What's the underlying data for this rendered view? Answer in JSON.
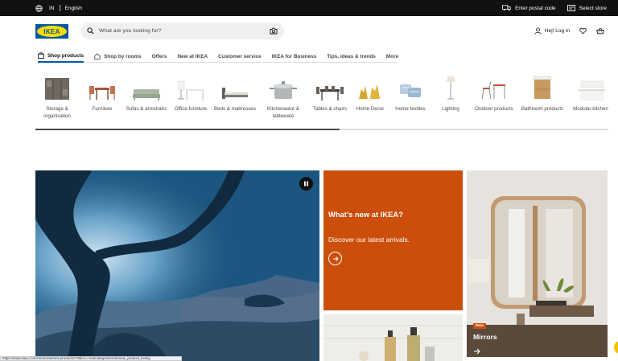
{
  "topbar": {
    "country": "IN",
    "language": "English",
    "postal": "Enter postal code",
    "store": "Select store"
  },
  "header": {
    "logo_text": "IKEA",
    "search_placeholder": "What are you looking for?",
    "login": "Hej! Log in"
  },
  "nav": [
    {
      "label": "Shop products",
      "active": true
    },
    {
      "label": "Shop by rooms"
    },
    {
      "label": "Offers"
    },
    {
      "label": "New at IKEA"
    },
    {
      "label": "Customer service"
    },
    {
      "label": "IKEA for Business"
    },
    {
      "label": "Tips, ideas & trends"
    },
    {
      "label": "More"
    }
  ],
  "categories": [
    {
      "line1": "Storage &",
      "line2": "organisation"
    },
    {
      "line1": "Furniture"
    },
    {
      "line1": "Sofas & armchairs"
    },
    {
      "line1": "Office furniture"
    },
    {
      "line1": "Beds & mattresses"
    },
    {
      "line1": "Kitchenware &",
      "line2": "tableware"
    },
    {
      "line1": "Tables & chairs"
    },
    {
      "line1": "Home Decor"
    },
    {
      "line1": "Home textiles"
    },
    {
      "line1": "Lighting"
    },
    {
      "line1": "Outdoor products"
    },
    {
      "line1": "Bathroom products"
    },
    {
      "line1": "Modular kitchen"
    }
  ],
  "promo": {
    "title": "What's new at IKEA?",
    "subtitle": "Discover our latest arrivals."
  },
  "mirrors": {
    "badge": "New",
    "label": "Mirrors"
  },
  "status_url": "https://www.ikea.com/in/en/new/new-products/?filters=f-subcategories%3Anew_product_listing",
  "colors": {
    "brand_blue": "#0058a3",
    "brand_yellow": "#ffdb00",
    "promo_orange": "#cc4e0b"
  }
}
